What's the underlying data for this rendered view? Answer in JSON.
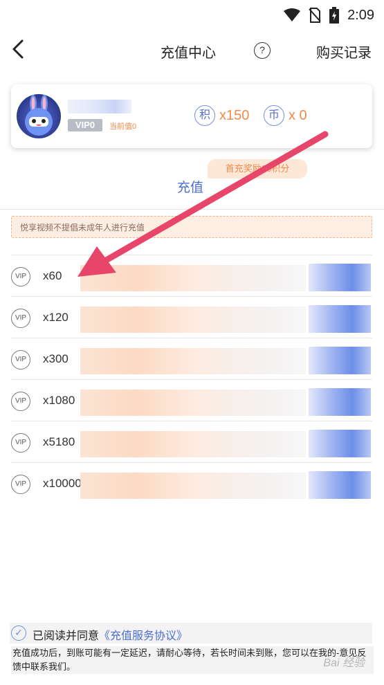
{
  "status_bar": {
    "time": "2:09",
    "icons": [
      "wifi-icon",
      "no-sim-icon",
      "battery-charging-icon"
    ]
  },
  "nav": {
    "title": "充值中心",
    "help_symbol": "?",
    "history_label": "购买记录"
  },
  "user_card": {
    "vip_label": "VIP0",
    "current_value_label": "当前值0",
    "points_symbol": "积",
    "points_value": "x150",
    "coins_symbol": "币",
    "coins_value": "x 0"
  },
  "recharge": {
    "tab_label": "充值",
    "bonus_text": "首充奖励60积分"
  },
  "notice": {
    "text": "悦享视频不提倡未成年人进行充值"
  },
  "packages": [
    {
      "icon": "VIP",
      "amount": "x60"
    },
    {
      "icon": "VIP",
      "amount": "x120"
    },
    {
      "icon": "VIP",
      "amount": "x300"
    },
    {
      "icon": "VIP",
      "amount": "x1080"
    },
    {
      "icon": "VIP",
      "amount": "x5180"
    },
    {
      "icon": "VIP",
      "amount": "x10000"
    }
  ],
  "agreement": {
    "check_symbol": "✓",
    "prefix": "已阅读并同意",
    "link": "《充值服务协议》"
  },
  "footnote": "充值成功后，到账可能有一定延迟，请耐心等待，若长时间未到账，您可以在我的-意见反馈中联系我们。",
  "watermark": "Bai 经验",
  "colors": {
    "accent_blue": "#4a6fd0",
    "accent_orange": "#f08a4b",
    "annotation_arrow": "#e8456a"
  }
}
